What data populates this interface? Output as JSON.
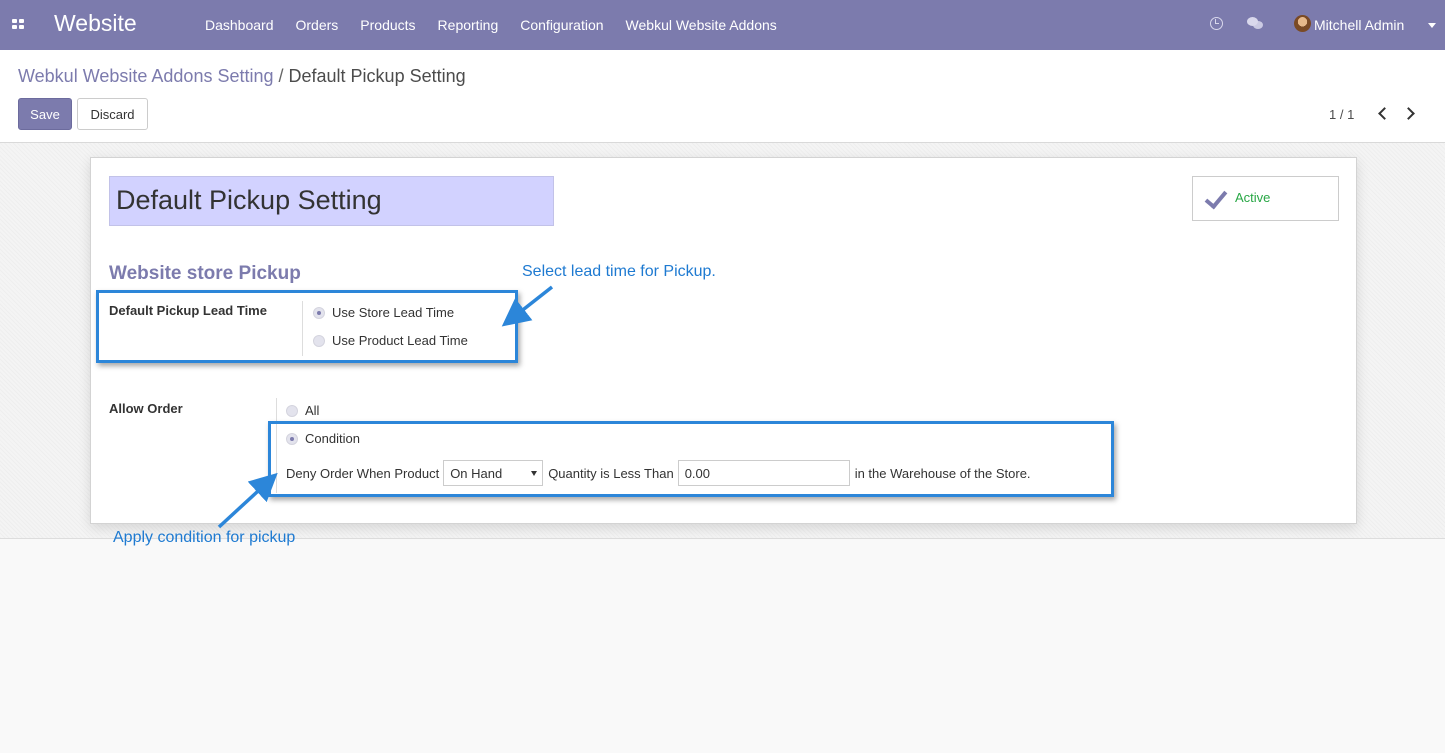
{
  "navbar": {
    "brand": "Website",
    "menu": [
      "Dashboard",
      "Orders",
      "Products",
      "Reporting",
      "Configuration",
      "Webkul Website Addons"
    ],
    "user": "Mitchell Admin",
    "icons": [
      "apps-icon",
      "clock-icon",
      "chat-icon",
      "avatar",
      "chevron-down-icon"
    ]
  },
  "breadcrumb": {
    "parent": "Webkul Website Addons Setting",
    "separator": " / ",
    "current": "Default Pickup Setting"
  },
  "buttons": {
    "save": "Save",
    "discard": "Discard"
  },
  "pager": {
    "value": "1 / 1"
  },
  "form": {
    "name": "Default Pickup Setting",
    "active_label": "Active",
    "section_title": "Website store Pickup",
    "lead_time": {
      "label": "Default Pickup Lead Time",
      "options": [
        {
          "label": "Use Store Lead Time",
          "checked": true
        },
        {
          "label": "Use Product Lead Time",
          "checked": false
        }
      ]
    },
    "allow_order": {
      "label": "Allow Order",
      "options": [
        {
          "label": "All",
          "checked": false
        },
        {
          "label": "Condition",
          "checked": true
        }
      ]
    },
    "deny": {
      "prefix": "Deny Order When Product",
      "select_value": "On Hand",
      "middle": "Quantity is Less Than",
      "quantity": "0.00",
      "suffix": "in the Warehouse of the Store."
    }
  },
  "annotations": {
    "lead_time_note": "Select lead time for Pickup.",
    "condition_note": "Apply condition for pickup"
  },
  "colors": {
    "brand": "#7c7bad",
    "name_field_bg": "#d2d2ff",
    "active_green": "#28a745",
    "annotation_blue": "#2c86d9"
  }
}
